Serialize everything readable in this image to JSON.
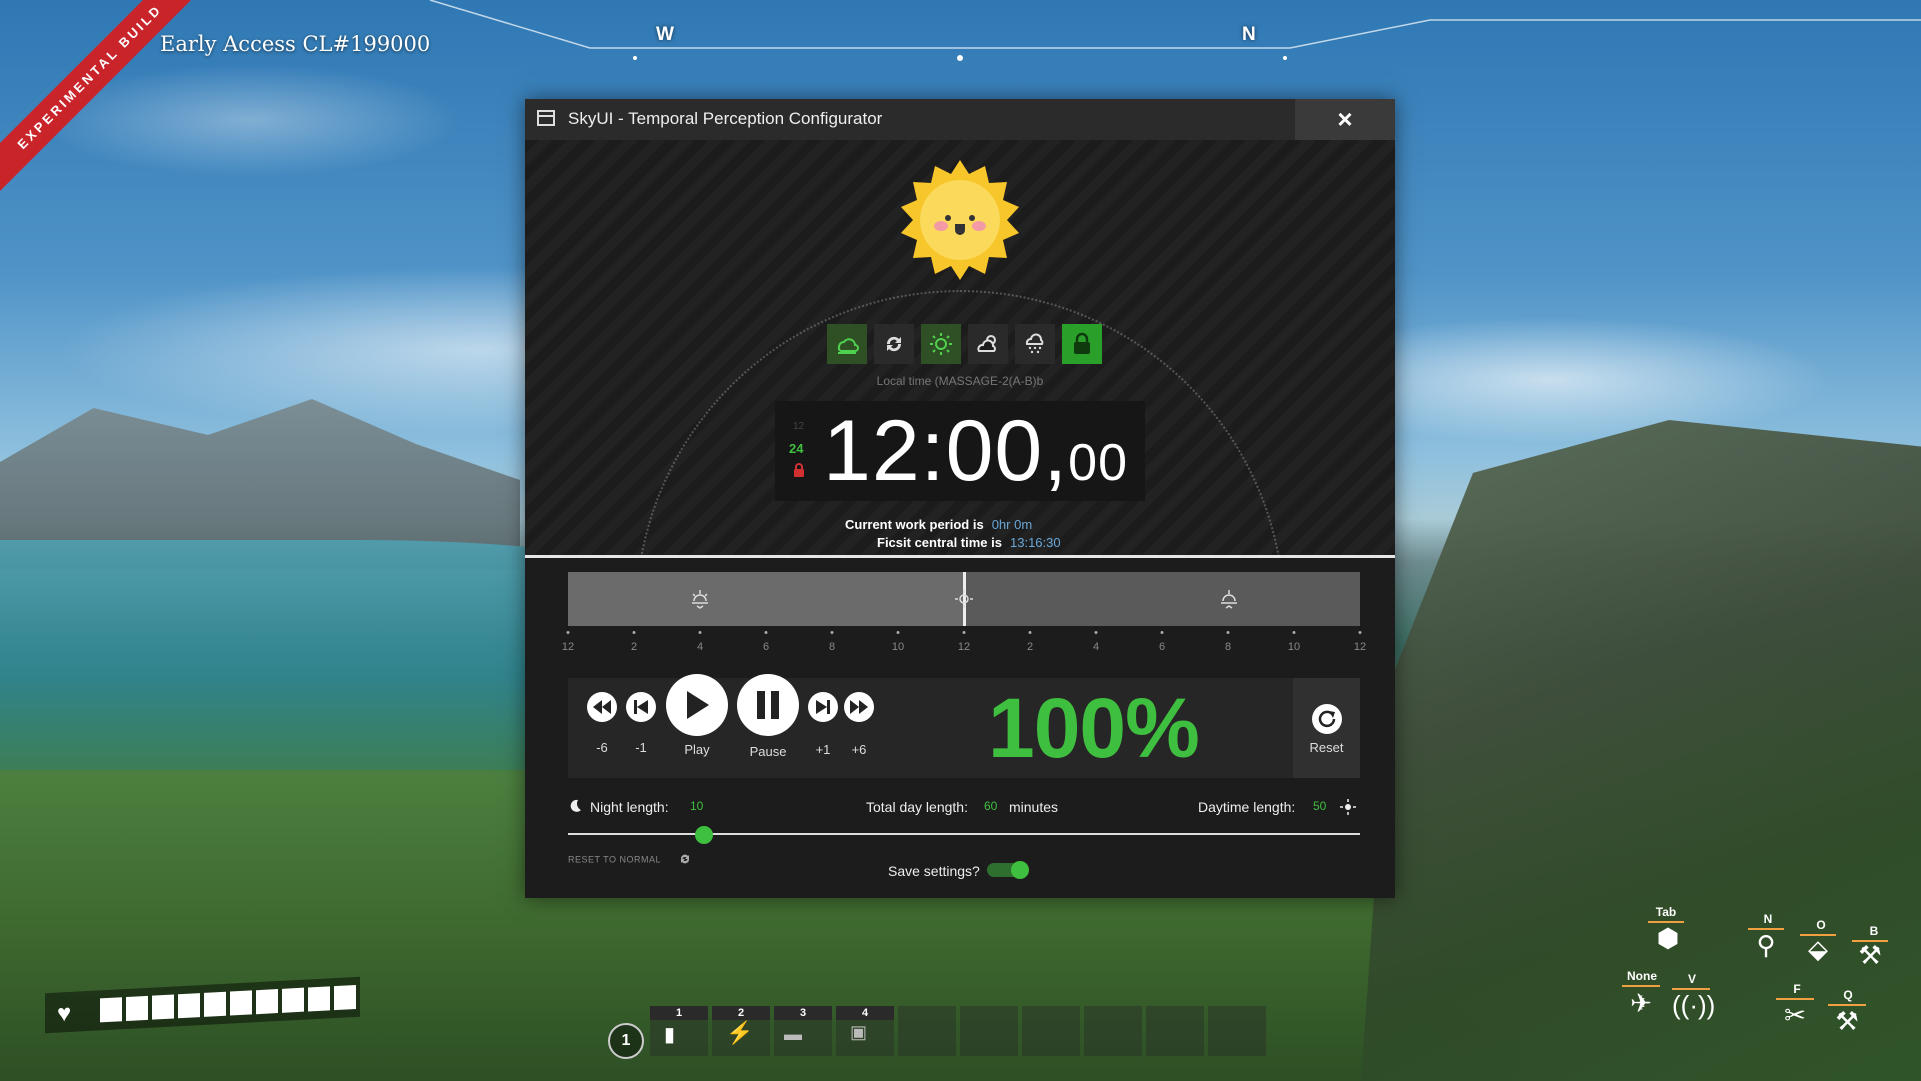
{
  "hud": {
    "build_banner": "EXPERIMENTAL BUILD",
    "build_version": "Early Access CL#199000",
    "compass": [
      "W",
      "N"
    ],
    "hotbar": [
      "1",
      "2",
      "3",
      "4"
    ],
    "hotbar_page": "1",
    "keys": {
      "tab": "Tab",
      "n": "N",
      "o": "O",
      "b": "B",
      "none": "None",
      "v": "V",
      "f": "F",
      "q": "Q"
    }
  },
  "window": {
    "title": "SkyUI - Temporal Perception Configurator",
    "close": "×"
  },
  "weather": {
    "buttons": [
      "cloud-sun-icon",
      "cycle-icon",
      "sun-icon",
      "partly-cloudy-icon",
      "snow-cloud-icon",
      "lock-icon"
    ],
    "active": [
      0,
      2
    ],
    "locked": 5
  },
  "clock": {
    "local_label": "Local time (MASSAGE-2(A-B)b",
    "format_12": "12",
    "format_24": "24",
    "hours": "12",
    "minutes": "00",
    "fraction": "00",
    "work_period_label": "Current work period is",
    "work_period_value": "0hr 0m",
    "central_label": "Ficsit central time is",
    "central_value": "13:16:30"
  },
  "day_ticks": [
    "12",
    "2",
    "4",
    "6",
    "8",
    "10",
    "12",
    "2",
    "4",
    "6",
    "8",
    "10",
    "12"
  ],
  "day_progress": 0.5,
  "controls": {
    "rewind6": "-6",
    "rewind1": "-1",
    "play": "Play",
    "pause": "Pause",
    "fwd1": "+1",
    "fwd6": "+6",
    "speed": "100%",
    "reset": "Reset"
  },
  "lengths": {
    "night_label": "Night length:",
    "night_value": "10",
    "total_label": "Total day length:",
    "total_value": "60",
    "total_unit": "minutes",
    "day_label": "Daytime length:",
    "day_value": "50",
    "reset_normal": "RESET TO NORMAL",
    "save_label": "Save settings?",
    "save_enabled": true
  },
  "colors": {
    "accent": "#3fbf3f",
    "info": "#6aa8d8",
    "lock": "#d03030"
  }
}
